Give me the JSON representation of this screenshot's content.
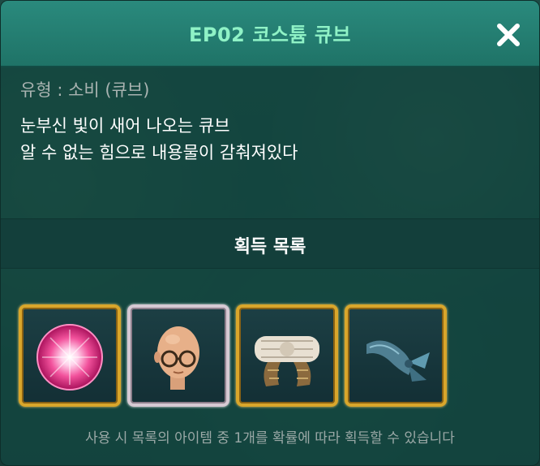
{
  "dialog": {
    "title": "EP02 코스튬 큐브",
    "close_icon": "close-icon",
    "type_line": "유형 : 소비 (큐브)",
    "description": [
      "눈부신 빛이 새어 나오는 큐브",
      "알 수 없는 힘으로 내용물이 감춰져있다"
    ],
    "section_title": "획득 목록",
    "items": [
      {
        "icon": "pink-orb-icon",
        "frame": "gold"
      },
      {
        "icon": "bald-head-glasses-icon",
        "frame": "silver"
      },
      {
        "icon": "bandage-roll-icon",
        "frame": "gold"
      },
      {
        "icon": "blue-scarf-icon",
        "frame": "gold"
      }
    ],
    "footer": "사용 시 목록의 아이템 중 1개를 확률에 따라 획득할 수 있습니다"
  },
  "colors": {
    "title_text": "#8ff2c6",
    "titlebar": "#2a8a7d",
    "gold_frame": "#d9a62b",
    "silver_frame": "#d6c9d3"
  }
}
